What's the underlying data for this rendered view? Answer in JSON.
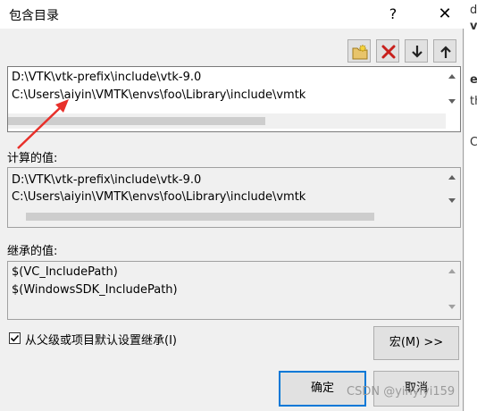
{
  "window": {
    "title": "包含目录",
    "help_label": "?",
    "close_label": "✕"
  },
  "background_fragments": [
    "d",
    "v",
    "e",
    "th",
    "C"
  ],
  "toolbar": {
    "icons": [
      "new-folder-icon",
      "delete-icon",
      "move-down-icon",
      "move-up-icon"
    ]
  },
  "editable_list": {
    "lines": [
      "D:\\VTK\\vtk-prefix\\include\\vtk-9.0",
      "C:\\Users\\aiyin\\VMTK\\envs\\foo\\Library\\include\\vmtk"
    ]
  },
  "computed": {
    "label": "计算的值:",
    "lines": [
      "D:\\VTK\\vtk-prefix\\include\\vtk-9.0",
      "C:\\Users\\aiyin\\VMTK\\envs\\foo\\Library\\include\\vmtk"
    ]
  },
  "inherited": {
    "label": "继承的值:",
    "lines": [
      "$(VC_IncludePath)",
      "$(WindowsSDK_IncludePath)"
    ]
  },
  "inherit_checkbox": {
    "label": "从父级或项目默认设置继承(I)",
    "checked": true
  },
  "buttons": {
    "macro": "宏(M) >>",
    "ok": "确定",
    "cancel": "取消"
  },
  "watermark": "CSDN @yinyiyi159",
  "colors": {
    "annotation_arrow": "#e8302a",
    "focus_border": "#0078d7"
  }
}
